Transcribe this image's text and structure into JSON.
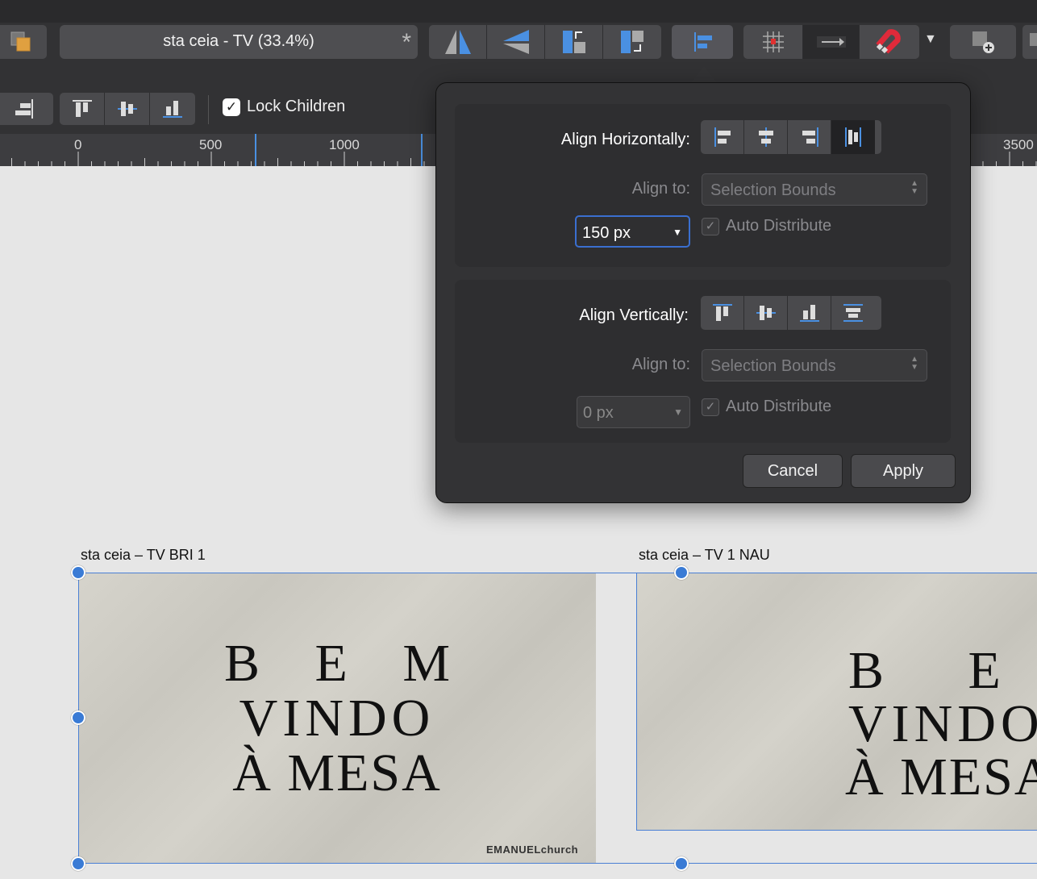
{
  "document": {
    "title": "sta ceia - TV (33.4%)",
    "modified_marker": "*"
  },
  "context_bar": {
    "lock_children_label": "Lock Children",
    "lock_children_checked": true
  },
  "ruler": {
    "ticks": [
      "0",
      "500",
      "1000",
      "3500"
    ]
  },
  "align_popup": {
    "horizontal": {
      "heading": "Align Horizontally:",
      "buttons": [
        "align-left",
        "align-center",
        "align-right",
        "distribute-horizontal"
      ],
      "active_button": "distribute-horizontal",
      "align_to_label": "Align to:",
      "align_to_value": "Selection Bounds",
      "spacing_value": "150 px",
      "auto_distribute_label": "Auto Distribute",
      "auto_distribute_checked": true
    },
    "vertical": {
      "heading": "Align Vertically:",
      "buttons": [
        "align-top",
        "align-middle",
        "align-bottom",
        "distribute-vertical"
      ],
      "align_to_label": "Align to:",
      "align_to_value": "Selection Bounds",
      "spacing_value": "0 px",
      "auto_distribute_label": "Auto Distribute",
      "auto_distribute_checked": true
    },
    "cancel_label": "Cancel",
    "apply_label": "Apply"
  },
  "artboards": [
    {
      "name": "sta ceia – TV BRI 1",
      "line1": "B E M",
      "line2": "VINDO",
      "line3": "À MESA",
      "brand": "EMANUELchurch"
    },
    {
      "name": "sta ceia – TV 1 NAU",
      "line1": "B E M",
      "line2": "VINDO",
      "line3": "À MESA"
    }
  ],
  "colors": {
    "accent": "#3a7bd5",
    "toolbar_bg": "#323234",
    "popup_bg": "#333335",
    "canvas_bg": "#e6e6e6"
  }
}
